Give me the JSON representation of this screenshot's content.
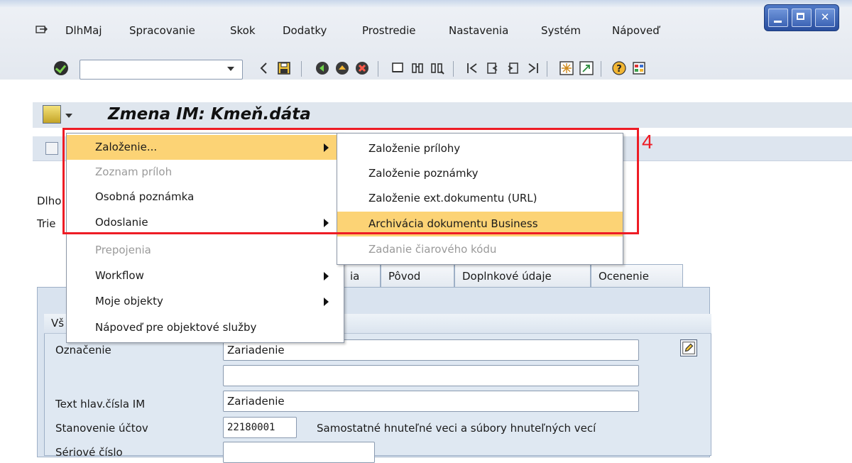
{
  "menubar": {
    "items": [
      "DlhMaj",
      "Spracovanie",
      "Skok",
      "Dodatky",
      "Prostredie",
      "Nastavenia",
      "Systém",
      "Nápoveď"
    ]
  },
  "toolbar": {
    "command_value": "",
    "icons": [
      "enter-icon",
      "back-icon",
      "save-icon",
      "back-green-icon",
      "exit-icon",
      "cancel-icon",
      "print-icon",
      "find-icon",
      "find-next-icon",
      "first-page-icon",
      "previous-page-icon",
      "next-page-icon",
      "last-page-icon",
      "new-session-icon",
      "shortcut-icon",
      "help-icon",
      "layout-icon"
    ]
  },
  "title": {
    "text": "Zmena IM:  Kmeň.dáta"
  },
  "background_labels": {
    "row1": "Dlho",
    "row2": "Trie",
    "group_title_partial": "Vš"
  },
  "tabs": [
    {
      "label": "ia"
    },
    {
      "label": "Pôvod"
    },
    {
      "label": "Doplnkové údaje"
    },
    {
      "label": "Ocenenie"
    }
  ],
  "form": {
    "oznacenie_label": "Označenie",
    "oznacenie_value": "Zariadenie",
    "oznacenie2_value": "",
    "text_label": "Text hlav.čísla IM",
    "text_value": "Zariadenie",
    "ucet_label": "Stanovenie účtov",
    "ucet_value": "22180001",
    "ucet_desc": "Samostatné hnuteľné veci a súbory hnuteľných vecí",
    "serial_label": "Sériové číslo",
    "serial_value": ""
  },
  "main_menu": {
    "items": [
      {
        "label": "Založenie...",
        "state": "highlighted",
        "submenu": true
      },
      {
        "label": "Zoznam príloh",
        "state": "disabled",
        "submenu": false
      },
      {
        "label": "Osobná poznámka",
        "state": "normal",
        "submenu": false
      },
      {
        "label": "Odoslanie",
        "state": "normal",
        "submenu": true
      },
      {
        "label": "Prepojenia",
        "state": "disabled",
        "submenu": false
      },
      {
        "label": "Workflow",
        "state": "normal",
        "submenu": true
      },
      {
        "label": "Moje objekty",
        "state": "normal",
        "submenu": true
      },
      {
        "label": "Nápoveď pre objektové služby",
        "state": "normal",
        "submenu": false
      }
    ]
  },
  "sub_menu": {
    "items": [
      {
        "label": "Založenie prílohy",
        "state": "normal"
      },
      {
        "label": "Založenie poznámky",
        "state": "normal"
      },
      {
        "label": "Založenie ext.dokumentu (URL)",
        "state": "normal"
      },
      {
        "label": "Archivácia dokumentu Business",
        "state": "highlighted"
      },
      {
        "label": "Zadanie čiarového kódu",
        "state": "disabled"
      }
    ]
  },
  "annotation": {
    "label": "4",
    "color": "#ee1c25"
  },
  "colors": {
    "highlight": "#fcd375",
    "annotation": "#ee1c25",
    "window_controls": "#3d64b5"
  }
}
